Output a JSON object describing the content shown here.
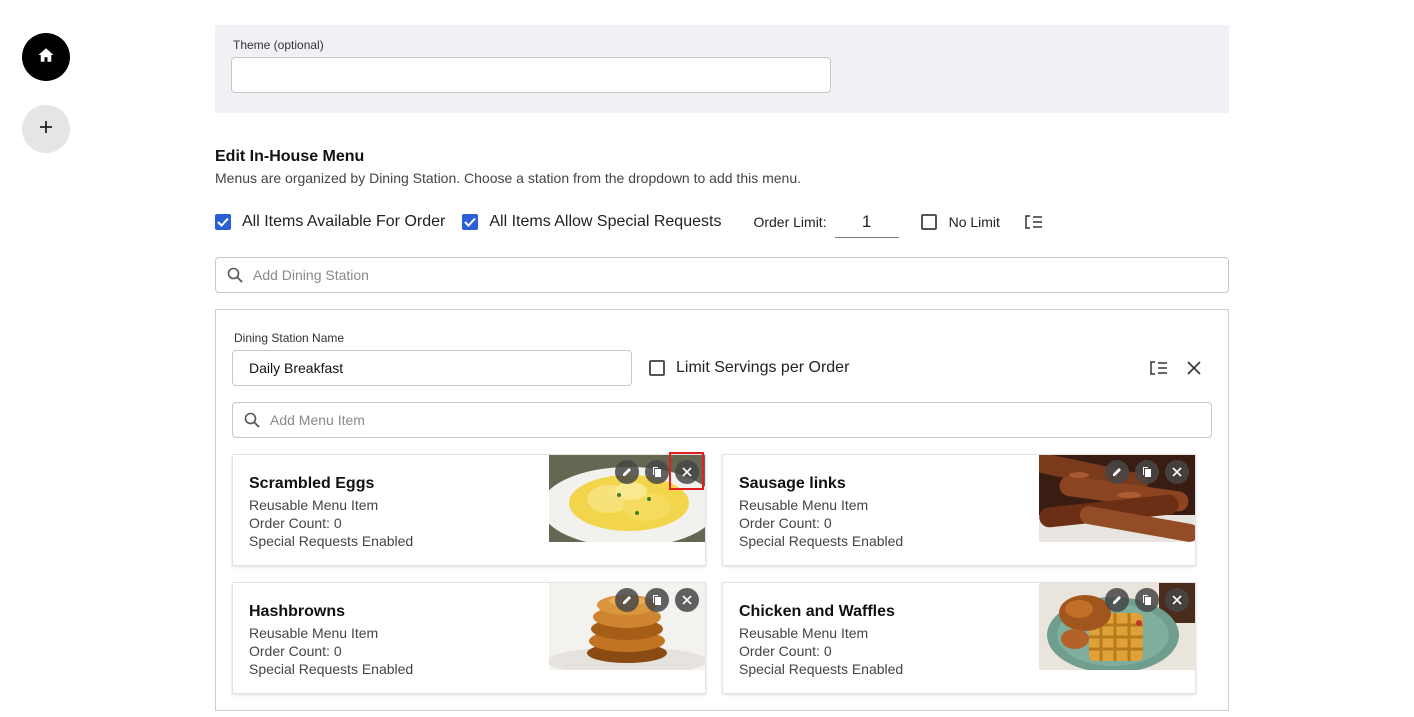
{
  "sidebar": {
    "home_icon": "home-icon",
    "add_icon": "plus-icon"
  },
  "theme": {
    "label": "Theme (optional)",
    "value": ""
  },
  "menu_section": {
    "title": "Edit In-House Menu",
    "description": "Menus are organized by Dining Station. Choose a station from the dropdown to add this menu."
  },
  "options": {
    "all_available_label": "All Items Available For Order",
    "all_available_checked": true,
    "special_requests_label": "All Items Allow Special Requests",
    "special_requests_checked": true,
    "order_limit_label": "Order Limit:",
    "order_limit_value": "1",
    "no_limit_label": "No Limit",
    "no_limit_checked": false
  },
  "station_search": {
    "placeholder": "Add Dining Station"
  },
  "station": {
    "name_label": "Dining Station Name",
    "name_value": "Daily Breakfast",
    "limit_servings_label": "Limit Servings per Order",
    "limit_servings_checked": false,
    "menu_item_placeholder": "Add Menu Item",
    "items": [
      {
        "title": "Scrambled Eggs",
        "type": "Reusable Menu Item",
        "order_count": "Order Count: 0",
        "special": "Special Requests Enabled",
        "image": "scrambled-eggs-photo"
      },
      {
        "title": "Sausage links",
        "type": "Reusable Menu Item",
        "order_count": "Order Count: 0",
        "special": "Special Requests Enabled",
        "image": "sausage-links-photo"
      },
      {
        "title": "Hashbrowns",
        "type": "Reusable Menu Item",
        "order_count": "Order Count: 0",
        "special": "Special Requests Enabled",
        "image": "hashbrowns-photo"
      },
      {
        "title": "Chicken and Waffles",
        "type": "Reusable Menu Item",
        "order_count": "Order Count: 0",
        "special": "Special Requests Enabled",
        "image": "chicken-and-waffles-photo"
      }
    ]
  },
  "colors": {
    "accent": "#2a5fd6",
    "highlight": "#e02020",
    "panel_bg": "#f0f1f4"
  }
}
